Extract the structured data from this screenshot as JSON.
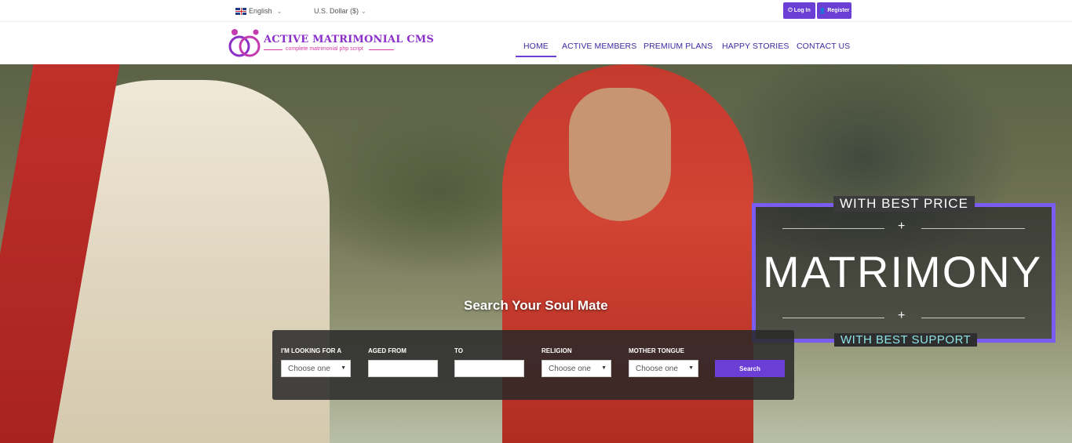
{
  "topbar": {
    "language": "English",
    "currency": "U.S. Dollar ($)",
    "login_label": "Log In",
    "register_label": "Register"
  },
  "header": {
    "logo_title": "ACTIVE MATRIMONIAL CMS",
    "logo_tagline": "complete matrimonial php script",
    "nav": [
      "HOME",
      "ACTIVE MEMBERS",
      "PREMIUM PLANS",
      "HAPPY STORIES",
      "CONTACT US"
    ]
  },
  "hero": {
    "badge_top": "WITH BEST PRICE",
    "badge_main": "MATRIMONY",
    "badge_bottom": "WITH BEST SUPPORT"
  },
  "search": {
    "title": "Search Your Soul Mate",
    "labels": [
      "I'M LOOKING FOR A",
      "AGED FROM",
      "TO",
      "RELIGION",
      "MOTHER TONGUE"
    ],
    "looking_for_value": "Choose one",
    "religion_value": "Choose one",
    "mother_tongue_value": "Choose one",
    "button": "Search"
  }
}
